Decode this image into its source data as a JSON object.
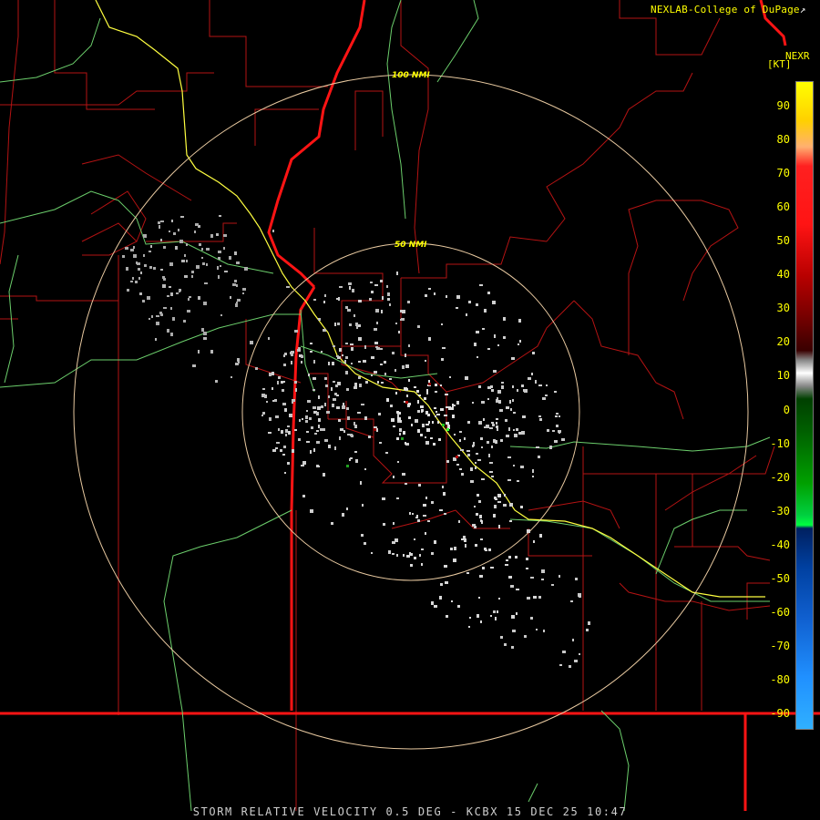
{
  "header": {
    "credit": "NEXLAB-College of DuPage",
    "credit_mark": "↗",
    "product": "NEXR",
    "unit": "[KT]"
  },
  "rings": [
    {
      "label": "100 NMI"
    },
    {
      "label": "50 NMI"
    }
  ],
  "colorbar": {
    "ticks": [
      {
        "label": "90",
        "value": 90
      },
      {
        "label": "80",
        "value": 80
      },
      {
        "label": "70",
        "value": 70
      },
      {
        "label": "60",
        "value": 60
      },
      {
        "label": "50",
        "value": 50
      },
      {
        "label": "40",
        "value": 40
      },
      {
        "label": "30",
        "value": 30
      },
      {
        "label": "20",
        "value": 20
      },
      {
        "label": "10",
        "value": 10
      },
      {
        "label": "0",
        "value": 0
      },
      {
        "label": "-10",
        "value": -10
      },
      {
        "label": "-20",
        "value": -20
      },
      {
        "label": "-30",
        "value": -30
      },
      {
        "label": "-40",
        "value": -40
      },
      {
        "label": "-50",
        "value": -50
      },
      {
        "label": "-60",
        "value": -60
      },
      {
        "label": "-70",
        "value": -70
      },
      {
        "label": "-80",
        "value": -80
      },
      {
        "label": "-90",
        "value": -90
      }
    ],
    "colors": {
      "ring": "#e8c9a0",
      "county": "#c81414",
      "state": "#ff1a1a",
      "highway": "#7fd67f",
      "interstate": "#ffff40",
      "label": "#ffff00"
    }
  },
  "footer": {
    "caption": "STORM RELATIVE VELOCITY 0.5 DEG - KCBX 15 DEC 25 10:47"
  }
}
